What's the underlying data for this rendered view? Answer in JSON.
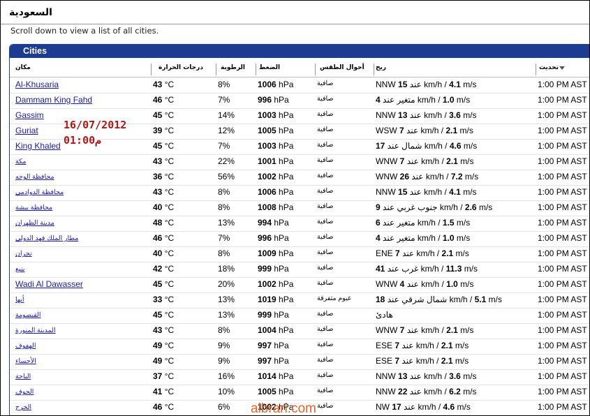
{
  "page": {
    "title": "السعودية",
    "subtitle": "Scroll down to view a list of all cities."
  },
  "panel": {
    "title": "Cities",
    "columns": {
      "city": "مكان",
      "temp": "درجات الحرارة",
      "humidity": "الرطوبة",
      "pressure": "الضغط",
      "conditions": "أحوال الطقس",
      "wind": "ريح",
      "updated": "تحديث"
    }
  },
  "rows": [
    {
      "city": "Al-Khusaria",
      "temp": "43",
      "hum": "8%",
      "pres": "1006",
      "cond": "صافية",
      "wdir": "NNW",
      "wspd": "15",
      "wtxt": "عند",
      "kmh": "km/h /",
      "ms": "4.1",
      "time": "1:00 PM AST"
    },
    {
      "city": "Dammam King Fahd",
      "temp": "46",
      "hum": "7%",
      "pres": "996",
      "cond": "صافية",
      "wdir": "",
      "wspd": "4",
      "wtxt": "متغير عند",
      "kmh": "km/h /",
      "ms": "1.0",
      "time": "1:00 PM AST"
    },
    {
      "city": "Gassim",
      "temp": "45",
      "hum": "14%",
      "pres": "1003",
      "cond": "صافية",
      "wdir": "NNW",
      "wspd": "13",
      "wtxt": "عند",
      "kmh": "km/h /",
      "ms": "3.6",
      "time": "1:00 PM AST"
    },
    {
      "city": "Guriat",
      "temp": "39",
      "hum": "12%",
      "pres": "1005",
      "cond": "صافية",
      "wdir": "WSW",
      "wspd": "7",
      "wtxt": "عند",
      "kmh": "km/h /",
      "ms": "2.1",
      "time": "1:00 PM AST"
    },
    {
      "city": "King Khaled",
      "temp": "45",
      "hum": "7%",
      "pres": "1003",
      "cond": "صافية",
      "wdir": "",
      "wspd": "17",
      "wtxt": "شمال عند",
      "kmh": "km/h /",
      "ms": "4.6",
      "time": "1:00 PM AST"
    },
    {
      "city": "مكة",
      "temp": "43",
      "hum": "22%",
      "pres": "1001",
      "cond": "صافية",
      "wdir": "WNW",
      "wspd": "7",
      "wtxt": "عند",
      "kmh": "km/h /",
      "ms": "2.1",
      "time": "1:00 PM AST"
    },
    {
      "city": "محافظة الوجه",
      "temp": "36",
      "hum": "56%",
      "pres": "1002",
      "cond": "صافية",
      "wdir": "WNW",
      "wspd": "26",
      "wtxt": "عند",
      "kmh": "km/h /",
      "ms": "7.2",
      "time": "1:00 PM AST"
    },
    {
      "city": "محافظة الدوادمي",
      "temp": "43",
      "hum": "8%",
      "pres": "1006",
      "cond": "صافية",
      "wdir": "NNW",
      "wspd": "15",
      "wtxt": "عند",
      "kmh": "km/h /",
      "ms": "4.1",
      "time": "1:00 PM AST"
    },
    {
      "city": "محافظة بيشة",
      "temp": "40",
      "hum": "8%",
      "pres": "1008",
      "cond": "صافية",
      "wdir": "",
      "wspd": "9",
      "wtxt": "جنوب غربي عند",
      "kmh": "km/h /",
      "ms": "2.6",
      "time": "1:00 PM AST"
    },
    {
      "city": "مدينة الظهران",
      "temp": "48",
      "hum": "13%",
      "pres": "994",
      "cond": "صافية",
      "wdir": "",
      "wspd": "6",
      "wtxt": "متغير عند",
      "kmh": "km/h /",
      "ms": "1.5",
      "time": "1:00 PM AST"
    },
    {
      "city": "مطار الملك فهد الدولي",
      "temp": "46",
      "hum": "7%",
      "pres": "996",
      "cond": "صافية",
      "wdir": "",
      "wspd": "4",
      "wtxt": "متغير عند",
      "kmh": "km/h /",
      "ms": "1.0",
      "time": "1:00 PM AST"
    },
    {
      "city": "نجران",
      "temp": "40",
      "hum": "8%",
      "pres": "1009",
      "cond": "صافية",
      "wdir": "ENE",
      "wspd": "7",
      "wtxt": "عند",
      "kmh": "km/h /",
      "ms": "2.1",
      "time": "1:00 PM AST"
    },
    {
      "city": "ينبع",
      "temp": "42",
      "hum": "18%",
      "pres": "999",
      "cond": "صافية",
      "wdir": "",
      "wspd": "41",
      "wtxt": "غرب عند",
      "kmh": "km/h /",
      "ms": "11.3",
      "time": "1:00 PM AST"
    },
    {
      "city": "Wadi Al Dawasser",
      "temp": "45",
      "hum": "20%",
      "pres": "1002",
      "cond": "صافية",
      "wdir": "WNW",
      "wspd": "4",
      "wtxt": "عند",
      "kmh": "km/h /",
      "ms": "1.0",
      "time": "1:00 PM AST"
    },
    {
      "city": "أبها",
      "temp": "33",
      "hum": "13%",
      "pres": "1019",
      "cond": "غيوم متفرقة",
      "wdir": "",
      "wspd": "18",
      "wtxt": "شمال شرقي عند",
      "kmh": "km/h /",
      "ms": "5.1",
      "time": "1:00 PM AST"
    },
    {
      "city": "القيصومة",
      "temp": "45",
      "hum": "13%",
      "pres": "999",
      "cond": "صافية",
      "wdir": "",
      "wspd": "",
      "wtxt": "هادئ",
      "kmh": "",
      "ms": "",
      "time": "1:00 PM AST"
    },
    {
      "city": "المدينة المنورة",
      "temp": "43",
      "hum": "8%",
      "pres": "1004",
      "cond": "صافية",
      "wdir": "WNW",
      "wspd": "7",
      "wtxt": "عند",
      "kmh": "km/h /",
      "ms": "2.1",
      "time": "1:00 PM AST"
    },
    {
      "city": "الهفوف",
      "temp": "49",
      "hum": "9%",
      "pres": "997",
      "cond": "صافية",
      "wdir": "ESE",
      "wspd": "7",
      "wtxt": "عند",
      "kmh": "km/h /",
      "ms": "2.1",
      "time": "1:00 PM AST"
    },
    {
      "city": "الأحساء",
      "temp": "49",
      "hum": "9%",
      "pres": "997",
      "cond": "صافية",
      "wdir": "ESE",
      "wspd": "7",
      "wtxt": "عند",
      "kmh": "km/h /",
      "ms": "2.1",
      "time": "1:00 PM AST"
    },
    {
      "city": "الباحة",
      "temp": "37",
      "hum": "16%",
      "pres": "1014",
      "cond": "صافية",
      "wdir": "NNW",
      "wspd": "13",
      "wtxt": "عند",
      "kmh": "km/h /",
      "ms": "3.6",
      "time": "1:00 PM AST"
    },
    {
      "city": "الجوف",
      "temp": "41",
      "hum": "10%",
      "pres": "1005",
      "cond": "صافية",
      "wdir": "NNW",
      "wspd": "22",
      "wtxt": "عند",
      "kmh": "km/h /",
      "ms": "6.2",
      "time": "1:00 PM AST"
    },
    {
      "city": "الخرج",
      "temp": "46",
      "hum": "6%",
      "pres": "1002",
      "cond": "صافية",
      "wdir": "NW",
      "wspd": "17",
      "wtxt": "عند",
      "kmh": "km/h /",
      "ms": "4.6",
      "time": "1:00 PM AST"
    }
  ],
  "units": {
    "temp": "°C",
    "pres": "hPa",
    "ms": "m/s"
  },
  "stamp": {
    "date": "16/07/2012",
    "time": "01:00م"
  },
  "watermark": "albrari.com"
}
